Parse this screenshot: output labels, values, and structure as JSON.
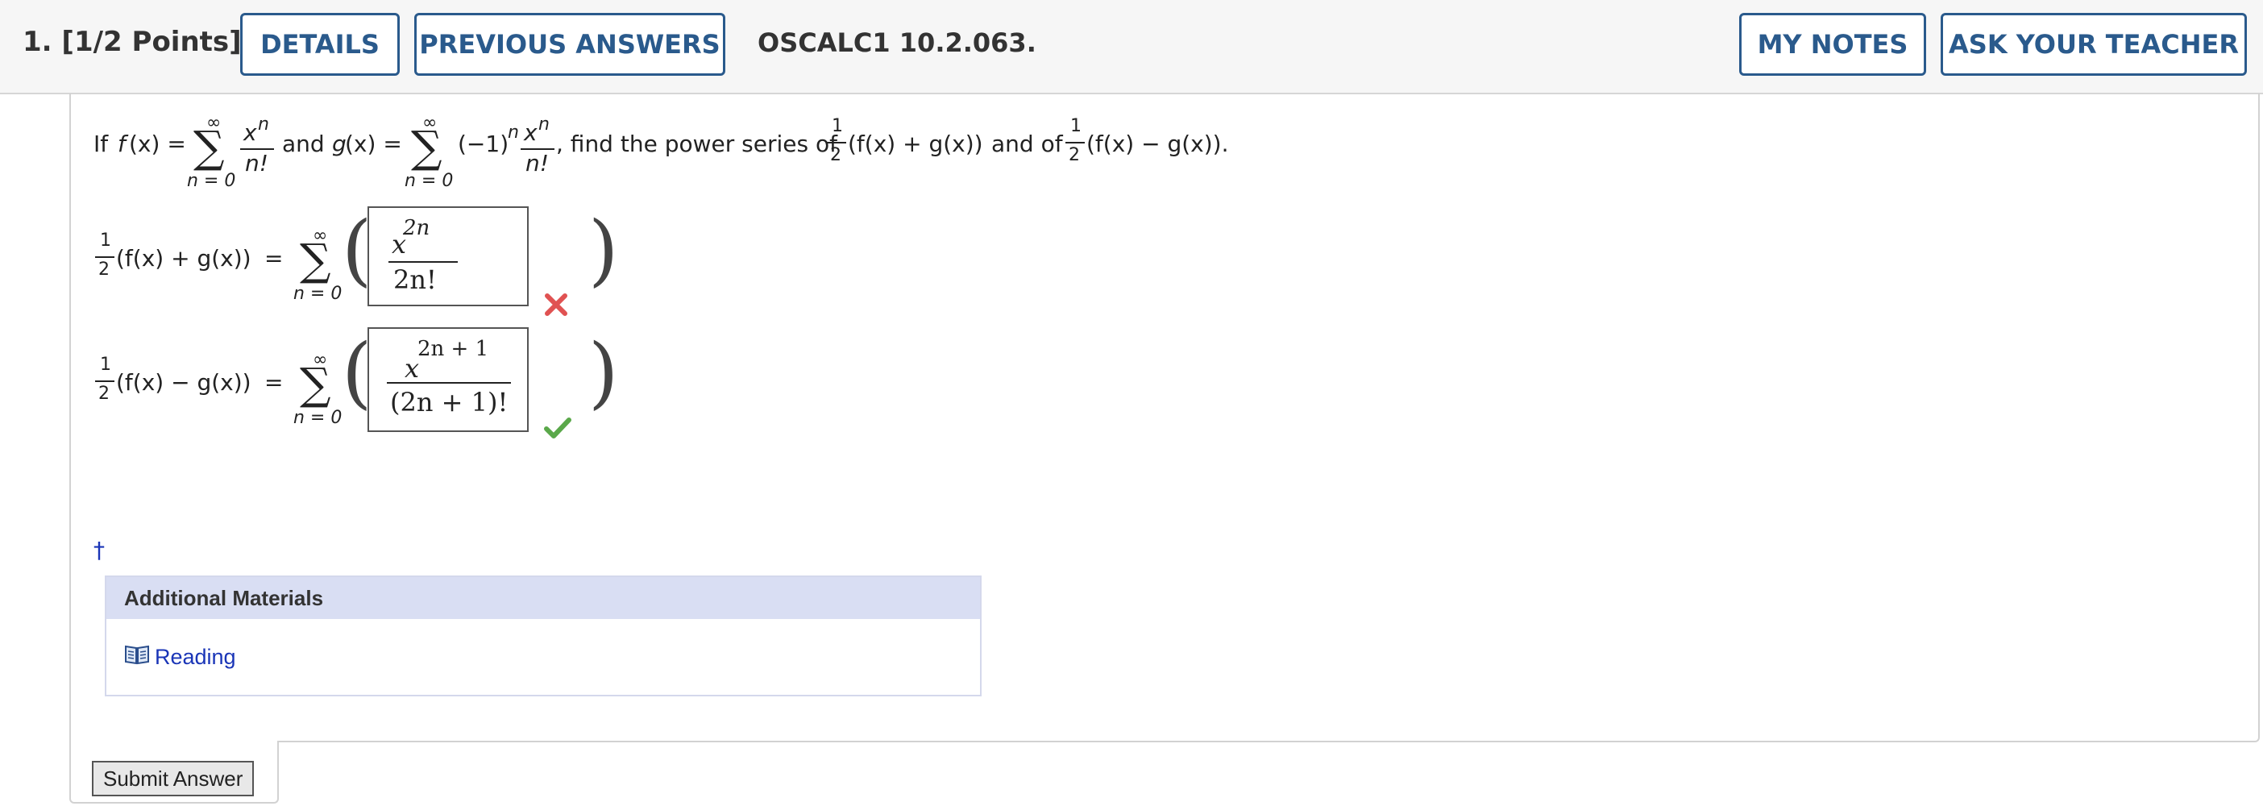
{
  "header": {
    "question_number": "1.",
    "points": "[1/2 Points]",
    "details_label": "DETAILS",
    "previous_answers_label": "PREVIOUS ANSWERS",
    "question_id": "OSCALC1 10.2.063.",
    "my_notes_label": "MY NOTES",
    "ask_teacher_label": "ASK YOUR TEACHER"
  },
  "problem": {
    "if": "If",
    "f_of_x": "f",
    "x_paren": "(x) =",
    "and": "and",
    "g_of_x": "g",
    "x_paren2": "(x) =",
    "neg_one": "(−1)",
    "n_exp": "n",
    "x": "x",
    "n": "n",
    "n_fact": "n!",
    "infinity": "∞",
    "n_equals_zero": "n = 0",
    "find_text": ", find the power series of",
    "half_num": "1",
    "half_den": "2",
    "sum_expr": "(f(x) + g(x))",
    "and_of": "and of",
    "diff_expr": "(f(x) − g(x)).",
    "comma": ","
  },
  "answers": [
    {
      "lhs": "(f(x) + g(x))",
      "eq": "=",
      "numerator_base": "x",
      "numerator_exp": "2n",
      "denominator": "2n!",
      "status": "incorrect",
      "status_color": "#e05252"
    },
    {
      "lhs": "(f(x) − g(x))",
      "eq": "=",
      "numerator_base": "x",
      "numerator_exp": "2n + 1",
      "denominator": "(2n + 1)!",
      "status": "correct",
      "status_color": "#5aa84a"
    }
  ],
  "footnote_marker": "†",
  "additional_materials": {
    "title": "Additional Materials",
    "reading_icon": "book-icon",
    "reading_label": "Reading"
  },
  "submit_label": "Submit Answer"
}
